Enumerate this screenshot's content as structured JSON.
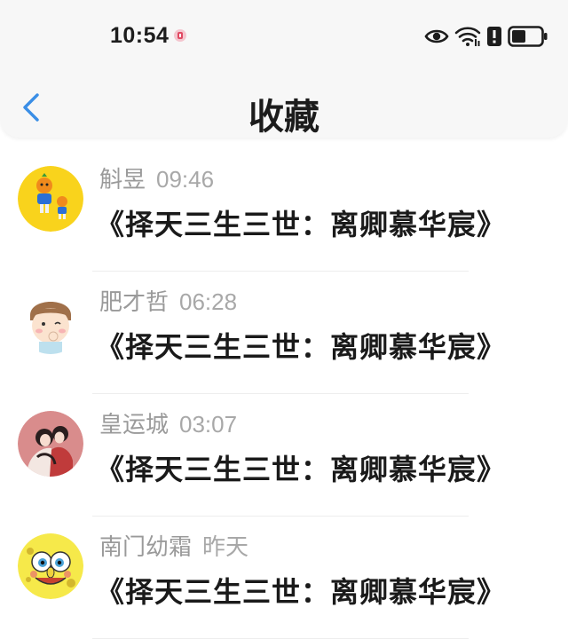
{
  "status_bar": {
    "time": "10:54",
    "icons": [
      "notification-icon",
      "eye-icon",
      "wifi-icon",
      "alert-icon",
      "battery-icon"
    ]
  },
  "header": {
    "title": "收藏",
    "back_icon": "chevron-left-icon",
    "accent_color": "#3a8ee6"
  },
  "favorites": [
    {
      "name": "斛昱",
      "time": "09:46",
      "content": "《择天三生三世：离卿慕华宸》",
      "avatar": "orange-cartoon-avatar"
    },
    {
      "name": "肥才哲",
      "time": "06:28",
      "content": "《择天三生三世：离卿慕华宸》",
      "avatar": "cartoon-boy-avatar"
    },
    {
      "name": "皇运城",
      "time": "03:07",
      "content": "《择天三生三世：离卿慕华宸》",
      "avatar": "couple-illustration-avatar"
    },
    {
      "name": "南门幼霜",
      "time": "昨天",
      "content": "《择天三生三世：离卿慕华宸》",
      "avatar": "spongebob-avatar"
    }
  ]
}
